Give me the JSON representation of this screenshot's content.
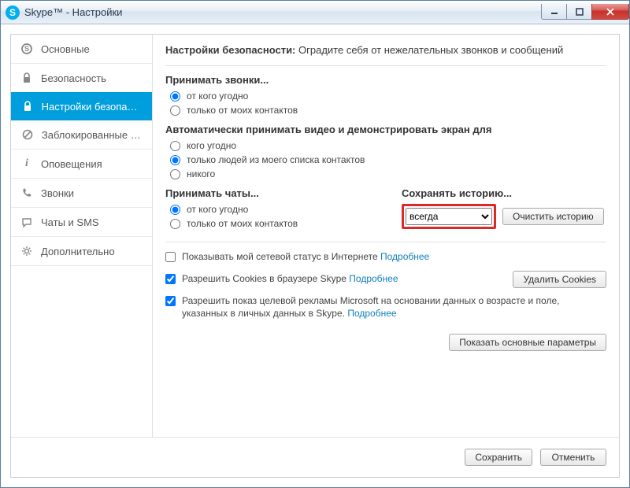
{
  "window": {
    "title": "Skype™ - Настройки"
  },
  "sidebar": {
    "items": [
      {
        "label": "Основные",
        "icon": "S"
      },
      {
        "label": "Безопасность",
        "icon": "lock"
      },
      {
        "label": "Настройки безопасно...",
        "icon": "lock",
        "active": true
      },
      {
        "label": "Заблокированные по...",
        "icon": "ban"
      },
      {
        "label": "Оповещения",
        "icon": "info"
      },
      {
        "label": "Звонки",
        "icon": "phone"
      },
      {
        "label": "Чаты и SMS",
        "icon": "chat"
      },
      {
        "label": "Дополнительно",
        "icon": "gear"
      }
    ]
  },
  "header": {
    "bold": "Настройки безопасности:",
    "rest": " Оградите себя от нежелательных звонков и сообщений"
  },
  "sections": {
    "calls": {
      "title": "Принимать звонки...",
      "opts": [
        "от кого угодно",
        "только от моих контактов"
      ],
      "selected": 0
    },
    "video": {
      "title": "Автоматически принимать видео и демонстрировать экран для",
      "opts": [
        "кого угодно",
        "только людей из моего списка контактов",
        "никого"
      ],
      "selected": 1
    },
    "chats": {
      "title": "Принимать чаты...",
      "opts": [
        "от кого угодно",
        "только от моих контактов"
      ],
      "selected": 0
    },
    "history": {
      "title": "Сохранять историю...",
      "select_value": "всегда",
      "clear_btn": "Очистить историю"
    }
  },
  "checks": {
    "status": {
      "checked": false,
      "label": "Показывать мой сетевой статус в Интернете ",
      "link": "Подробнее"
    },
    "cookies": {
      "checked": true,
      "label": "Разрешить Cookies в браузере Skype ",
      "link": "Подробнее",
      "btn": "Удалить Cookies"
    },
    "ads": {
      "checked": true,
      "label": "Разрешить показ целевой рекламы Microsoft на основании данных о возрасте и поле, указанных в личных данных в Skype. ",
      "link": "Подробнее"
    }
  },
  "footer": {
    "show_basic": "Показать основные параметры",
    "save": "Сохранить",
    "cancel": "Отменить"
  }
}
